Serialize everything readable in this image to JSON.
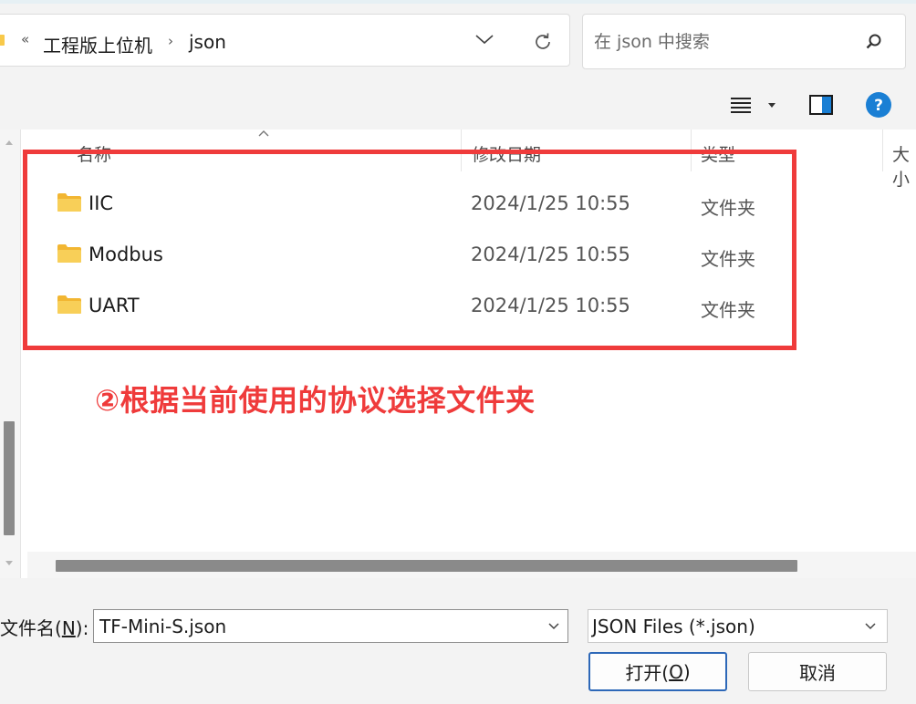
{
  "address_bar": {
    "overflow_symbol": "«",
    "crumbs": [
      "工程版上位机",
      "json"
    ],
    "separator": "›"
  },
  "search": {
    "placeholder": "在 json 中搜索"
  },
  "columns": {
    "name": "名称",
    "modified": "修改日期",
    "type": "类型",
    "size": "大小"
  },
  "files": [
    {
      "name": "IIC",
      "modified": "2024/1/25 10:55",
      "type": "文件夹"
    },
    {
      "name": "Modbus",
      "modified": "2024/1/25 10:55",
      "type": "文件夹"
    },
    {
      "name": "UART",
      "modified": "2024/1/25 10:55",
      "type": "文件夹"
    }
  ],
  "annotation": "②根据当前使用的协议选择文件夹",
  "bottom": {
    "filename_label_prefix": "文件名(",
    "filename_label_key": "N",
    "filename_label_suffix": "):",
    "filename_value": "TF-Mini-S.json",
    "filter_value": "JSON Files (*.json)",
    "open_prefix": "打开(",
    "open_key": "O",
    "open_suffix": ")",
    "cancel": "取消"
  },
  "colors": {
    "annotation_red": "#ef3b3b",
    "folder_yellow": "#f8c94a",
    "help_blue": "#1a7fd4",
    "accent_border": "#2d68b8"
  }
}
